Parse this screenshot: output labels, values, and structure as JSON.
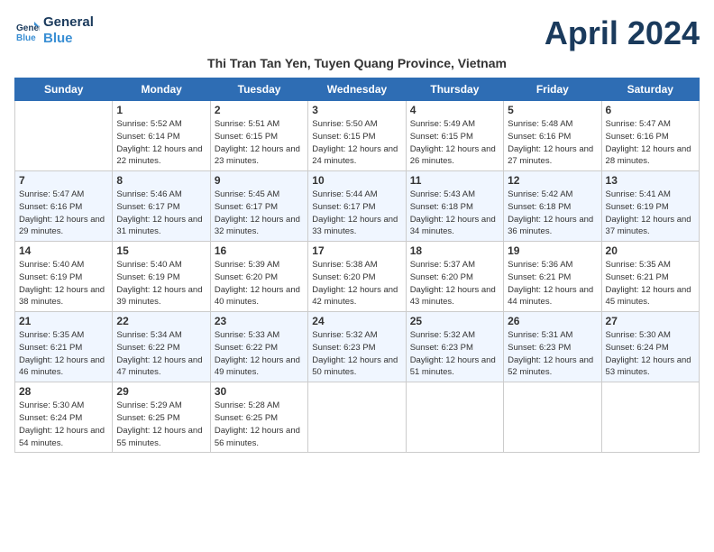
{
  "header": {
    "logo_line1": "General",
    "logo_line2": "Blue",
    "title": "April 2024",
    "subtitle": "Thi Tran Tan Yen, Tuyen Quang Province, Vietnam"
  },
  "weekdays": [
    "Sunday",
    "Monday",
    "Tuesday",
    "Wednesday",
    "Thursday",
    "Friday",
    "Saturday"
  ],
  "weeks": [
    [
      {
        "day": "",
        "info": ""
      },
      {
        "day": "1",
        "info": "Sunrise: 5:52 AM\nSunset: 6:14 PM\nDaylight: 12 hours\nand 22 minutes."
      },
      {
        "day": "2",
        "info": "Sunrise: 5:51 AM\nSunset: 6:15 PM\nDaylight: 12 hours\nand 23 minutes."
      },
      {
        "day": "3",
        "info": "Sunrise: 5:50 AM\nSunset: 6:15 PM\nDaylight: 12 hours\nand 24 minutes."
      },
      {
        "day": "4",
        "info": "Sunrise: 5:49 AM\nSunset: 6:15 PM\nDaylight: 12 hours\nand 26 minutes."
      },
      {
        "day": "5",
        "info": "Sunrise: 5:48 AM\nSunset: 6:16 PM\nDaylight: 12 hours\nand 27 minutes."
      },
      {
        "day": "6",
        "info": "Sunrise: 5:47 AM\nSunset: 6:16 PM\nDaylight: 12 hours\nand 28 minutes."
      }
    ],
    [
      {
        "day": "7",
        "info": "Sunrise: 5:47 AM\nSunset: 6:16 PM\nDaylight: 12 hours\nand 29 minutes."
      },
      {
        "day": "8",
        "info": "Sunrise: 5:46 AM\nSunset: 6:17 PM\nDaylight: 12 hours\nand 31 minutes."
      },
      {
        "day": "9",
        "info": "Sunrise: 5:45 AM\nSunset: 6:17 PM\nDaylight: 12 hours\nand 32 minutes."
      },
      {
        "day": "10",
        "info": "Sunrise: 5:44 AM\nSunset: 6:17 PM\nDaylight: 12 hours\nand 33 minutes."
      },
      {
        "day": "11",
        "info": "Sunrise: 5:43 AM\nSunset: 6:18 PM\nDaylight: 12 hours\nand 34 minutes."
      },
      {
        "day": "12",
        "info": "Sunrise: 5:42 AM\nSunset: 6:18 PM\nDaylight: 12 hours\nand 36 minutes."
      },
      {
        "day": "13",
        "info": "Sunrise: 5:41 AM\nSunset: 6:19 PM\nDaylight: 12 hours\nand 37 minutes."
      }
    ],
    [
      {
        "day": "14",
        "info": "Sunrise: 5:40 AM\nSunset: 6:19 PM\nDaylight: 12 hours\nand 38 minutes."
      },
      {
        "day": "15",
        "info": "Sunrise: 5:40 AM\nSunset: 6:19 PM\nDaylight: 12 hours\nand 39 minutes."
      },
      {
        "day": "16",
        "info": "Sunrise: 5:39 AM\nSunset: 6:20 PM\nDaylight: 12 hours\nand 40 minutes."
      },
      {
        "day": "17",
        "info": "Sunrise: 5:38 AM\nSunset: 6:20 PM\nDaylight: 12 hours\nand 42 minutes."
      },
      {
        "day": "18",
        "info": "Sunrise: 5:37 AM\nSunset: 6:20 PM\nDaylight: 12 hours\nand 43 minutes."
      },
      {
        "day": "19",
        "info": "Sunrise: 5:36 AM\nSunset: 6:21 PM\nDaylight: 12 hours\nand 44 minutes."
      },
      {
        "day": "20",
        "info": "Sunrise: 5:35 AM\nSunset: 6:21 PM\nDaylight: 12 hours\nand 45 minutes."
      }
    ],
    [
      {
        "day": "21",
        "info": "Sunrise: 5:35 AM\nSunset: 6:21 PM\nDaylight: 12 hours\nand 46 minutes."
      },
      {
        "day": "22",
        "info": "Sunrise: 5:34 AM\nSunset: 6:22 PM\nDaylight: 12 hours\nand 47 minutes."
      },
      {
        "day": "23",
        "info": "Sunrise: 5:33 AM\nSunset: 6:22 PM\nDaylight: 12 hours\nand 49 minutes."
      },
      {
        "day": "24",
        "info": "Sunrise: 5:32 AM\nSunset: 6:23 PM\nDaylight: 12 hours\nand 50 minutes."
      },
      {
        "day": "25",
        "info": "Sunrise: 5:32 AM\nSunset: 6:23 PM\nDaylight: 12 hours\nand 51 minutes."
      },
      {
        "day": "26",
        "info": "Sunrise: 5:31 AM\nSunset: 6:23 PM\nDaylight: 12 hours\nand 52 minutes."
      },
      {
        "day": "27",
        "info": "Sunrise: 5:30 AM\nSunset: 6:24 PM\nDaylight: 12 hours\nand 53 minutes."
      }
    ],
    [
      {
        "day": "28",
        "info": "Sunrise: 5:30 AM\nSunset: 6:24 PM\nDaylight: 12 hours\nand 54 minutes."
      },
      {
        "day": "29",
        "info": "Sunrise: 5:29 AM\nSunset: 6:25 PM\nDaylight: 12 hours\nand 55 minutes."
      },
      {
        "day": "30",
        "info": "Sunrise: 5:28 AM\nSunset: 6:25 PM\nDaylight: 12 hours\nand 56 minutes."
      },
      {
        "day": "",
        "info": ""
      },
      {
        "day": "",
        "info": ""
      },
      {
        "day": "",
        "info": ""
      },
      {
        "day": "",
        "info": ""
      }
    ]
  ]
}
